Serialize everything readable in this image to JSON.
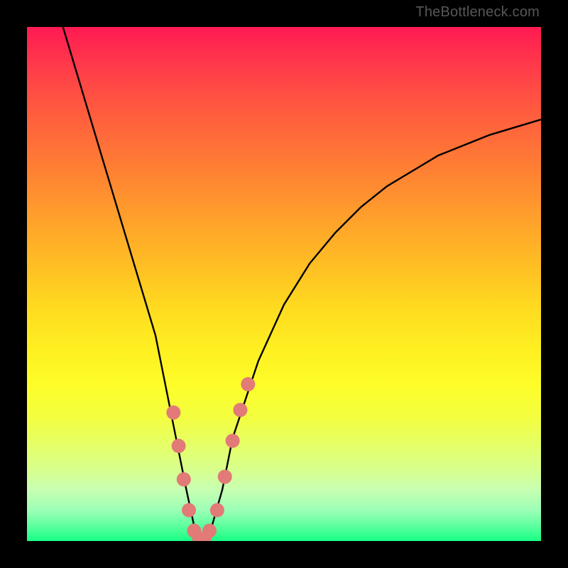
{
  "watermark": "TheBottleneck.com",
  "chart_data": {
    "type": "line",
    "title": "",
    "xlabel": "",
    "ylabel": "",
    "xlim": [
      0,
      100
    ],
    "ylim": [
      0,
      100
    ],
    "grid": false,
    "legend": false,
    "series": [
      {
        "name": "bottleneck-curve",
        "x": [
          7,
          10,
          13,
          16,
          19,
          22,
          25,
          27,
          29,
          31,
          32.5,
          34,
          36,
          38,
          40,
          45,
          50,
          55,
          60,
          65,
          70,
          75,
          80,
          85,
          90,
          95,
          100
        ],
        "values": [
          100,
          90,
          80,
          70,
          60,
          50,
          40,
          30,
          20,
          10,
          3,
          0,
          3,
          10,
          20,
          35,
          46,
          54,
          60,
          65,
          69,
          72,
          75,
          77,
          79,
          80.5,
          82
        ]
      }
    ],
    "markers": {
      "name": "highlight-dots",
      "color": "#e27a77",
      "points": [
        {
          "x": 28.5,
          "y": 25.0
        },
        {
          "x": 29.5,
          "y": 18.5
        },
        {
          "x": 30.5,
          "y": 12.0
        },
        {
          "x": 31.5,
          "y": 6.0
        },
        {
          "x": 32.5,
          "y": 2.0
        },
        {
          "x": 33.5,
          "y": 0.5
        },
        {
          "x": 34.5,
          "y": 0.5
        },
        {
          "x": 35.5,
          "y": 2.0
        },
        {
          "x": 37.0,
          "y": 6.0
        },
        {
          "x": 38.5,
          "y": 12.5
        },
        {
          "x": 40.0,
          "y": 19.5
        },
        {
          "x": 41.5,
          "y": 25.5
        },
        {
          "x": 43.0,
          "y": 30.5
        }
      ]
    }
  }
}
